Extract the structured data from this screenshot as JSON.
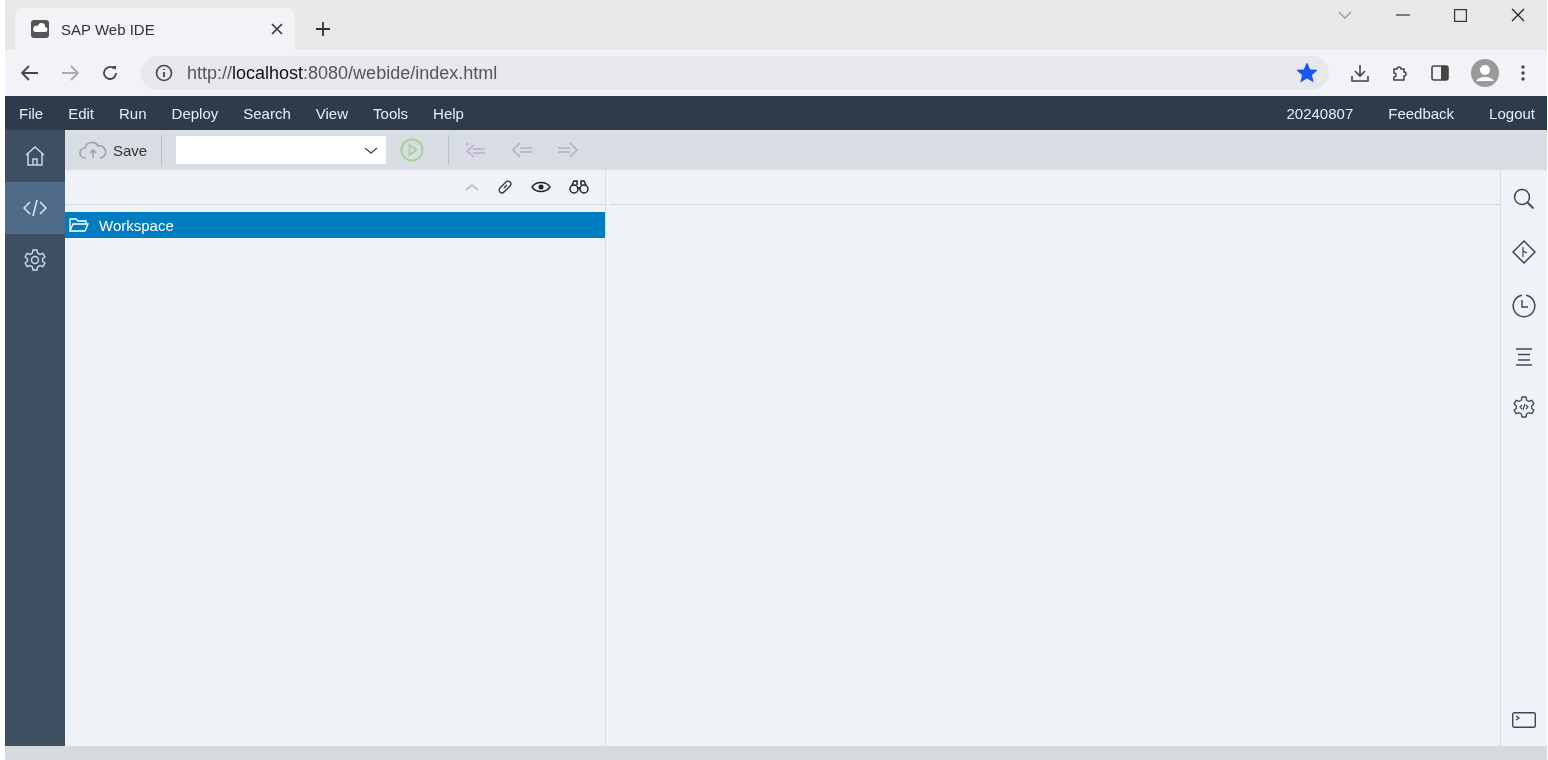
{
  "browser": {
    "tab_title": "SAP Web IDE",
    "url_host": "localhost",
    "url_prefix": "http://",
    "url_rest": ":8080/webide/index.html",
    "bookmarked": true
  },
  "menu": {
    "items": [
      "File",
      "Edit",
      "Run",
      "Deploy",
      "Search",
      "View",
      "Tools",
      "Help"
    ],
    "right_items": [
      "20240807",
      "Feedback",
      "Logout"
    ]
  },
  "sidebar": {
    "items": [
      {
        "kind": "home",
        "selected": false
      },
      {
        "kind": "code",
        "selected": true
      },
      {
        "kind": "settings",
        "selected": false
      }
    ]
  },
  "toolbar": {
    "save_label": "Save"
  },
  "tree": {
    "items": [
      {
        "label": "Workspace",
        "selected": true
      }
    ]
  },
  "right_rail": {
    "items": [
      {
        "kind": "search"
      },
      {
        "kind": "git"
      },
      {
        "kind": "history"
      },
      {
        "kind": "outline"
      },
      {
        "kind": "api"
      }
    ]
  }
}
